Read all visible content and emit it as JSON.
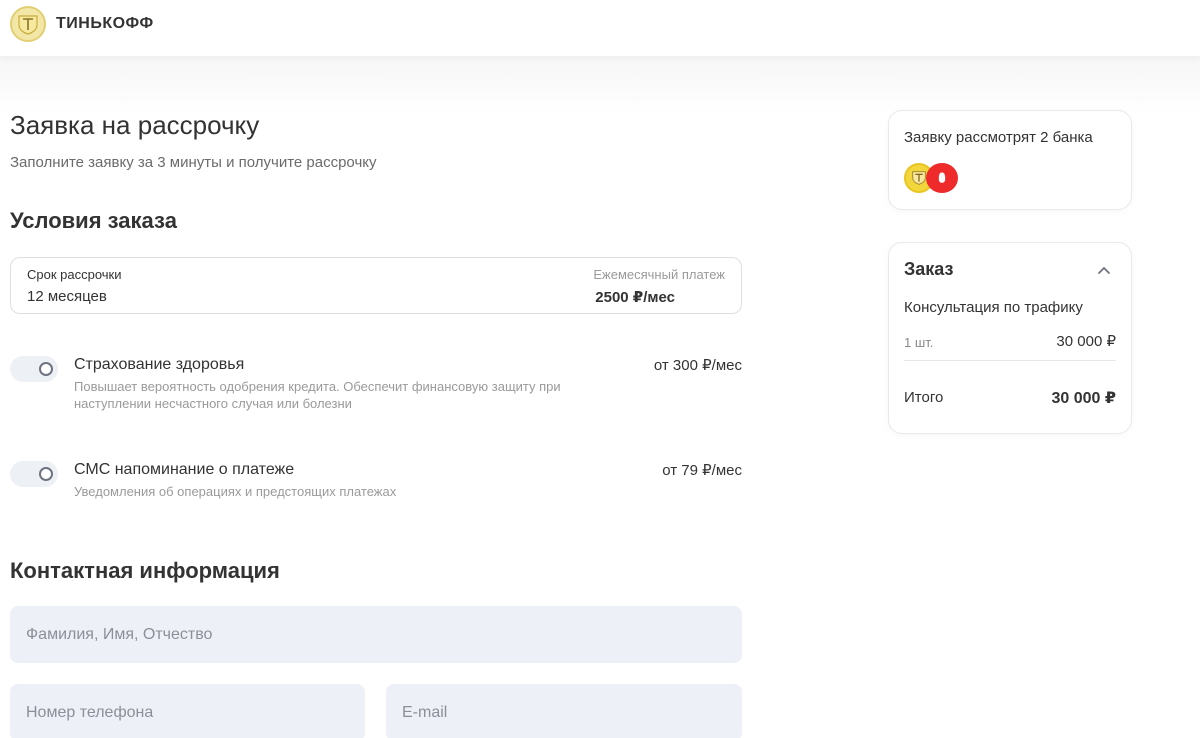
{
  "header": {
    "brand": "ТИНЬКОФФ",
    "logo_icon": "tinkoff-shield-icon"
  },
  "main": {
    "title": "Заявка на рассрочку",
    "subtitle": "Заполните заявку за 3 минуты и получите рассрочку",
    "conditions_title": "Условия заказа",
    "term": {
      "label": "Срок рассрочки",
      "value": "12 месяцев",
      "payment_label": "Ежемесячный платеж",
      "payment_value": "2500 ₽/мес"
    },
    "options": [
      {
        "title": "Страхование здоровья",
        "description": "Повышает вероятность одобрения кредита. Обеспечит финансовую защиту при наступлении несчастного случая или болезни",
        "price": "от 300 ₽/мес",
        "enabled": false
      },
      {
        "title": "СМС напоминание о платеже",
        "description": "Уведомления об операциях и предстоящих платежах",
        "price": "от 79 ₽/мес",
        "enabled": false
      }
    ],
    "contact_title": "Контактная информация",
    "fields": {
      "full_name_placeholder": "Фамилия, Имя, Отчество",
      "phone_placeholder": "Номер телефона",
      "email_placeholder": "E-mail"
    }
  },
  "sidebar": {
    "banks": {
      "title": "Заявку рассмотрят 2 банка",
      "icons": [
        "tinkoff-bank-icon",
        "alfa-bank-icon"
      ]
    },
    "order": {
      "title": "Заказ",
      "item_name": "Консультация по трафику",
      "item_qty": "1 шт.",
      "item_price": "30 000 ₽",
      "total_label": "Итого",
      "total_value": "30 000 ₽"
    }
  },
  "colors": {
    "text": "#333333",
    "muted": "#9a9a9a",
    "field_bg": "#edf0f6",
    "tinkoff_yellow": "#f3d63b",
    "alfa_red": "#ef2a2a"
  }
}
